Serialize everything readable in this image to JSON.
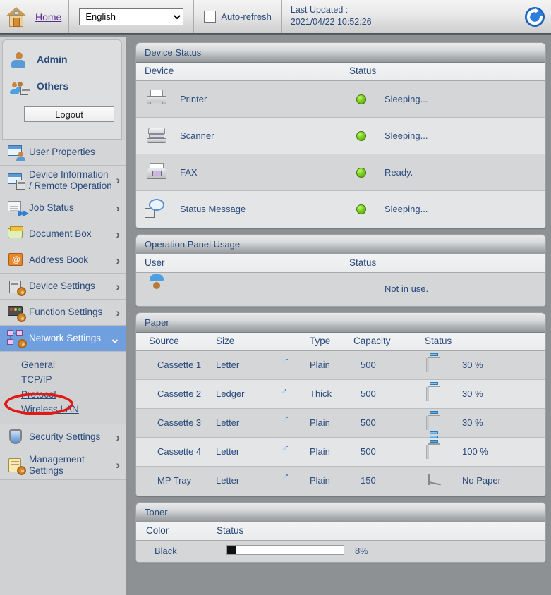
{
  "topbar": {
    "home_label": "Home",
    "language_selected": "English",
    "language_options": [
      "English"
    ],
    "autorefresh_label": "Auto-refresh",
    "last_updated_label": "Last Updated :",
    "last_updated_value": "2021/04/22 10:52:26"
  },
  "sidebar": {
    "user_admin": "Admin",
    "user_others": "Others",
    "logout_label": "Logout",
    "items": [
      {
        "label": "User Properties",
        "chevron": "",
        "selected": false
      },
      {
        "label": "Device Information / Remote Operation",
        "chevron": "›",
        "selected": false
      },
      {
        "label": "Job Status",
        "chevron": "›",
        "selected": false
      },
      {
        "label": "Document Box",
        "chevron": "›",
        "selected": false
      },
      {
        "label": "Address Book",
        "chevron": "›",
        "selected": false
      },
      {
        "label": "Device Settings",
        "chevron": "›",
        "selected": false
      },
      {
        "label": "Function Settings",
        "chevron": "›",
        "selected": false
      },
      {
        "label": "Network Settings",
        "chevron": "⌄",
        "selected": true
      },
      {
        "label": "Security Settings",
        "chevron": "›",
        "selected": false
      },
      {
        "label": "Management Settings",
        "chevron": "›",
        "selected": false
      }
    ],
    "subitems": [
      {
        "label": "General"
      },
      {
        "label": "TCP/IP"
      },
      {
        "label": "Protocol"
      },
      {
        "label": "Wireless LAN"
      }
    ],
    "highlight_target": "Protocol",
    "highlight_color": "#e01b16"
  },
  "device_status": {
    "title": "Device Status",
    "columns": [
      "Device",
      "Status"
    ],
    "rows": [
      {
        "device": "Printer",
        "status": "Sleeping...",
        "led": "green"
      },
      {
        "device": "Scanner",
        "status": "Sleeping...",
        "led": "green"
      },
      {
        "device": "FAX",
        "status": "Ready.",
        "led": "green"
      },
      {
        "device": "Status Message",
        "status": "Sleeping...",
        "led": "green"
      }
    ]
  },
  "operation_panel": {
    "title": "Operation Panel Usage",
    "columns": [
      "User",
      "Status"
    ],
    "rows": [
      {
        "user": "",
        "status": "Not in use."
      }
    ]
  },
  "paper": {
    "title": "Paper",
    "columns": [
      "Source",
      "Size",
      "Type",
      "Capacity",
      "Status"
    ],
    "rows": [
      {
        "source": "Cassette 1",
        "size": "Letter",
        "type": "Plain",
        "capacity": "500",
        "status": "30 %",
        "level": 30,
        "orient": "portrait"
      },
      {
        "source": "Cassette 2",
        "size": "Ledger",
        "type": "Thick",
        "capacity": "500",
        "status": "30 %",
        "level": 30,
        "orient": "landscape"
      },
      {
        "source": "Cassette 3",
        "size": "Letter",
        "type": "Plain",
        "capacity": "500",
        "status": "30 %",
        "level": 30,
        "orient": "portrait"
      },
      {
        "source": "Cassette 4",
        "size": "Letter",
        "type": "Plain",
        "capacity": "500",
        "status": "100 %",
        "level": 100,
        "orient": "portrait"
      },
      {
        "source": "MP Tray",
        "size": "Letter",
        "type": "Plain",
        "capacity": "150",
        "status": "No Paper",
        "level": 0,
        "orient": "portrait"
      }
    ]
  },
  "toner": {
    "title": "Toner",
    "columns": [
      "Color",
      "Status"
    ],
    "rows": [
      {
        "color": "Black",
        "percent_label": "8%",
        "percent": 8,
        "bar_color": "#111111"
      }
    ]
  },
  "colors": {
    "text_blue": "#2a4a7c",
    "selection_blue": "#6f9fdf",
    "link_purple": "#5b2d8e",
    "led_green": "#7ed321",
    "page_bg": "#8e9194"
  }
}
